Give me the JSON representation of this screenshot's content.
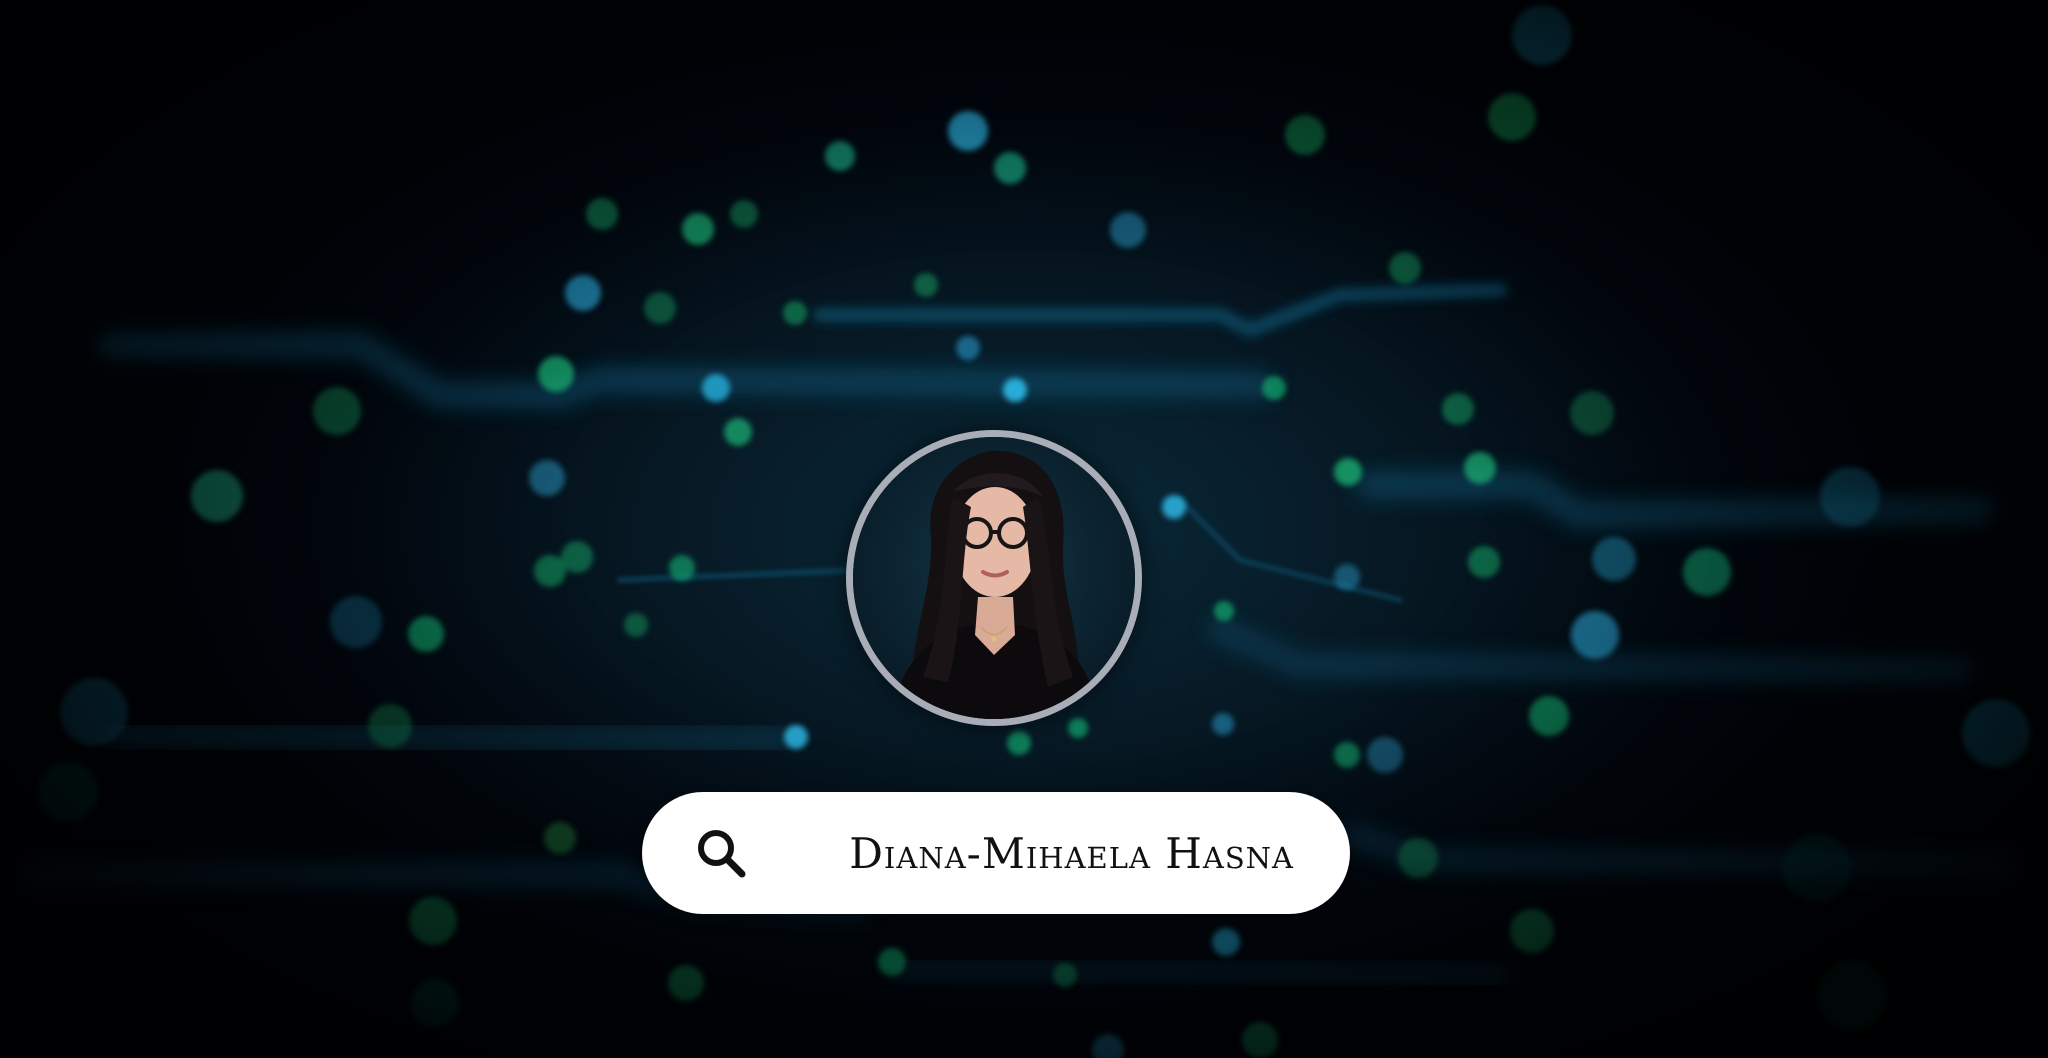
{
  "background": {
    "colors": {
      "blue_glow": "#1aa3d9",
      "green_glow": "#17c27a",
      "deep": "#02060d"
    }
  },
  "profile": {
    "avatar_icon": "profile-photo",
    "ring_color": "#a9adb8"
  },
  "search": {
    "icon": "search-icon",
    "query": "Diana-Mihaela Hasna"
  }
}
